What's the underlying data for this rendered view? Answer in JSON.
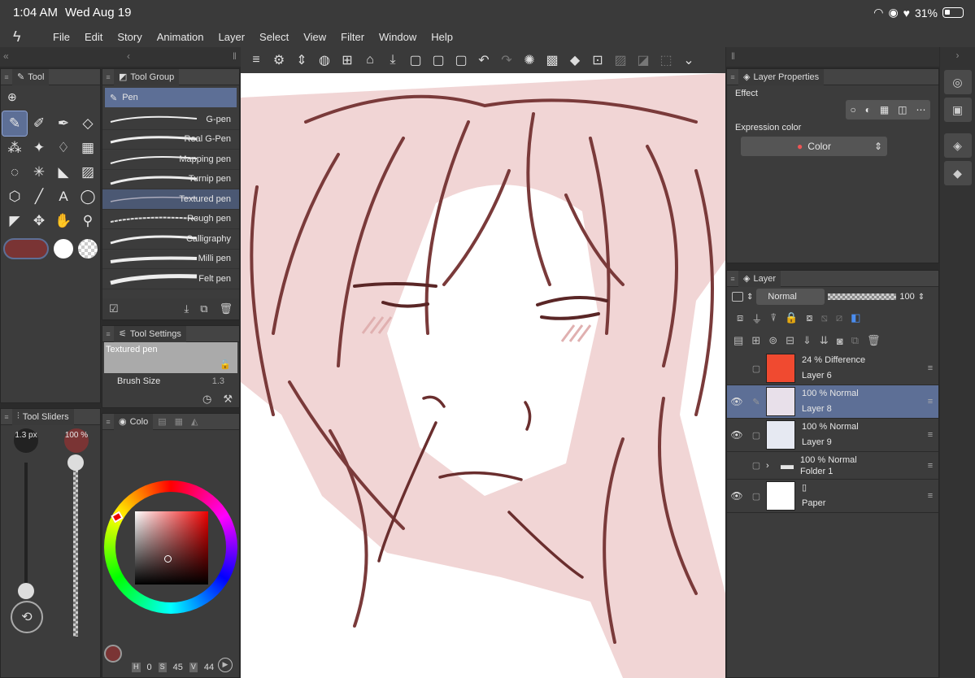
{
  "statusbar": {
    "time": "1:04 AM",
    "date": "Wed Aug 19",
    "battery": "31%"
  },
  "menu": [
    "File",
    "Edit",
    "Story",
    "Animation",
    "Layer",
    "Select",
    "View",
    "Filter",
    "Window",
    "Help"
  ],
  "tool_panel": {
    "title": "Tool"
  },
  "tool_group": {
    "title": "Tool Group",
    "selected": "Pen",
    "brushes": [
      "G-pen",
      "Real G-Pen",
      "Mapping pen",
      "Turnip pen",
      "Textured pen",
      "Rough pen",
      "Calligraphy",
      "Milli pen",
      "Felt pen"
    ]
  },
  "tool_settings": {
    "title": "Tool Settings",
    "tool_name": "Textured pen",
    "brush_size_label": "Brush Size",
    "brush_size_value": "1.3"
  },
  "tool_sliders": {
    "title": "Tool Sliders",
    "size": "1.3 px",
    "opacity": "100 %"
  },
  "color_panel": {
    "tab_label": "Colo",
    "h_label": "H",
    "h_value": "0",
    "s_label": "S",
    "s_value": "45",
    "v_label": "V",
    "v_value": "44"
  },
  "layer_properties": {
    "title": "Layer Properties",
    "effect_label": "Effect",
    "expression_color_label": "Expression color",
    "expression_color_value": "Color"
  },
  "layer_panel": {
    "title": "Layer",
    "blend_mode": "Normal",
    "opacity": "100",
    "layers": [
      {
        "opacity_mode": "24 % Difference",
        "name": "Layer 6",
        "visible": false,
        "selected": false,
        "thumb_color": "#f04a30"
      },
      {
        "opacity_mode": "100 % Normal",
        "name": "Layer 8",
        "visible": true,
        "selected": true,
        "thumb_color": "#e8e0ea"
      },
      {
        "opacity_mode": "100 % Normal",
        "name": "Layer 9",
        "visible": true,
        "selected": false,
        "thumb_color": "#e6e9f2"
      },
      {
        "opacity_mode": "100 % Normal",
        "name": "Folder 1",
        "visible": false,
        "selected": false,
        "thumb_color": ""
      },
      {
        "opacity_mode": "",
        "name": "Paper",
        "visible": true,
        "selected": false,
        "thumb_color": "#ffffff"
      }
    ]
  },
  "colors": {
    "main_color": "#7a3434",
    "accent": "#5d6f96",
    "sketch_line": "#7a3a3a",
    "sketch_fill": "#f2d4d4"
  }
}
